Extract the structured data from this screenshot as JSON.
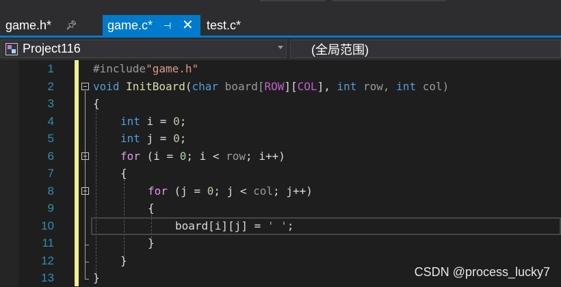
{
  "tabs": [
    {
      "label": "game.h*",
      "active": false,
      "pinned": true
    },
    {
      "label": "game.c*",
      "active": true,
      "pinned": true
    },
    {
      "label": "test.c*",
      "active": false
    }
  ],
  "nav": {
    "project": "Project116",
    "scope": "(全局范围)"
  },
  "editor": {
    "line_numbers": [
      "1",
      "2",
      "3",
      "4",
      "5",
      "6",
      "7",
      "8",
      "9",
      "10",
      "11",
      "12",
      "13"
    ],
    "code": {
      "l1_pre": "#include",
      "l1_str": "\"game.h\"",
      "l2_void": "void",
      "l2_fn": "InitBoard",
      "l2_open": "(",
      "l2_char": "char",
      "l2_board": " board[",
      "l2_row": "ROW",
      "l2_mid": "][",
      "l2_col": "COL",
      "l2_end": "], ",
      "l2_int1": "int",
      "l2_rowp": " row, ",
      "l2_int2": "int",
      "l2_colp": " col)",
      "l3": "{",
      "l4_int": "int",
      "l4_rest": " i = ",
      "l4_num": "0",
      "l4_semi": ";",
      "l5_int": "int",
      "l5_rest": " j = ",
      "l5_num": "0",
      "l5_semi": ";",
      "l6_for": "for",
      "l6_rest1": " (i = ",
      "l6_num": "0",
      "l6_rest2": "; i < ",
      "l6_row": "row",
      "l6_rest3": "; i++)",
      "l7": "{",
      "l8_for": "for",
      "l8_rest1": " (j = ",
      "l8_num": "0",
      "l8_rest2": "; j < ",
      "l8_col": "col",
      "l8_rest3": "; j++)",
      "l9": "{",
      "l10_a": "board[i][j] = ",
      "l10_str": "' '",
      "l10_semi": ";",
      "l11": "}",
      "l12": "}",
      "l13": "}"
    }
  },
  "watermark": "CSDN @process_lucky7",
  "colors": {
    "active_tab": "#007acc",
    "line_numbers": "#2b91af",
    "change_bar": "#efef91",
    "keyword": "#569cd6",
    "function": "#dcdcaa",
    "macro": "#bd63c5"
  }
}
